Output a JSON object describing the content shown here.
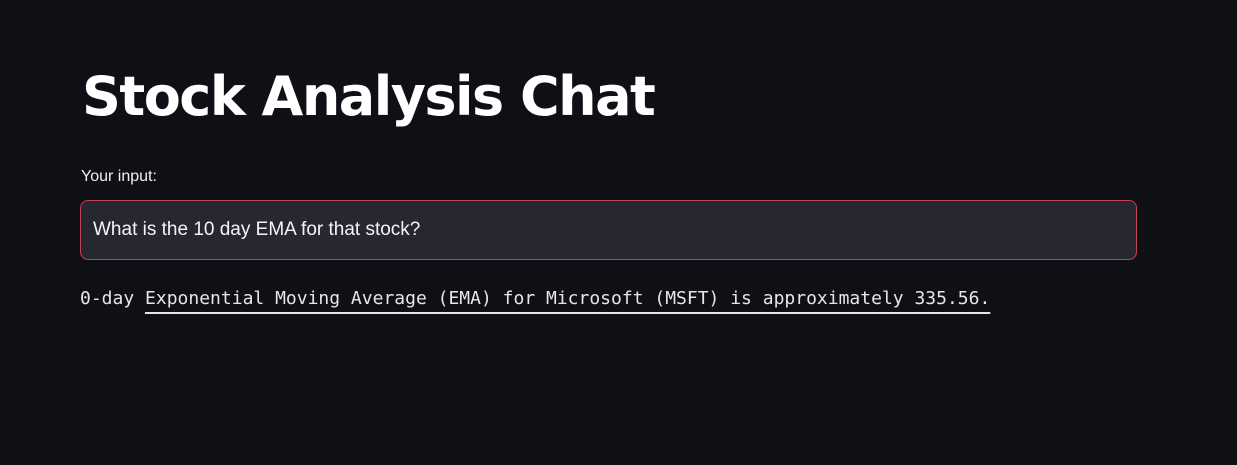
{
  "app": {
    "title": "Stock Analysis Chat"
  },
  "input": {
    "label": "Your input:",
    "value": "What is the 10 day EMA for that stock?"
  },
  "response": {
    "prefix": "0-day",
    "text": "Exponential Moving Average (EMA) for Microsoft (MSFT) is approximately 335.56."
  },
  "colors": {
    "background": "#0e1016",
    "input_background": "#262730",
    "input_focus_border": "#c2424f"
  }
}
